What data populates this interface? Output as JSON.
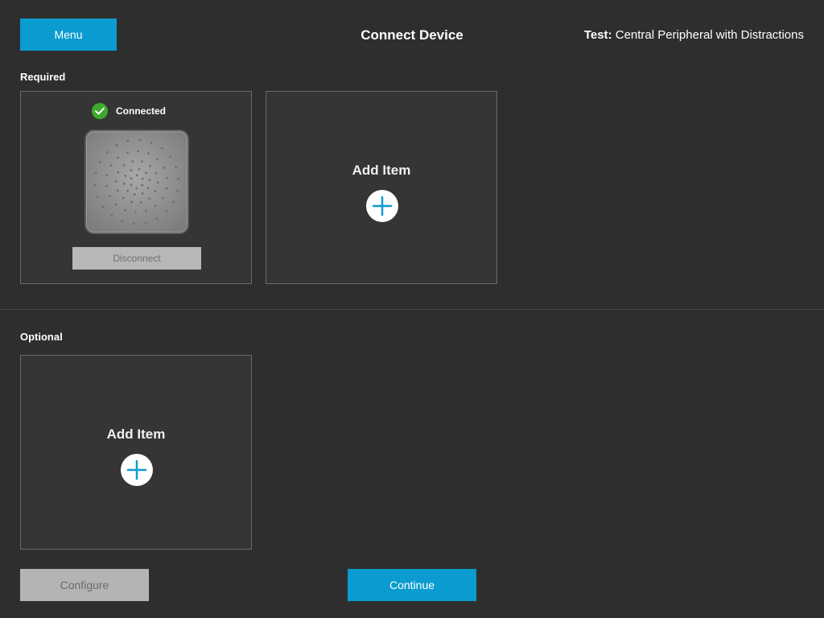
{
  "header": {
    "menu_label": "Menu",
    "title": "Connect Device",
    "test_prefix": "Test:",
    "test_name": "Central Peripheral with Distractions"
  },
  "required": {
    "label": "Required",
    "connected_card": {
      "status_text": "Connected",
      "disconnect_label": "Disconnect"
    },
    "add_card": {
      "label": "Add Item"
    }
  },
  "optional": {
    "label": "Optional",
    "add_card": {
      "label": "Add Item"
    }
  },
  "footer": {
    "configure_label": "Configure",
    "continue_label": "Continue"
  },
  "colors": {
    "accent": "#0a9cd0",
    "background": "#2e2e2e",
    "success": "#3eaa2c",
    "disabled": "#b4b4b4"
  },
  "icons": {
    "status": "check-icon",
    "add": "plus-icon"
  }
}
